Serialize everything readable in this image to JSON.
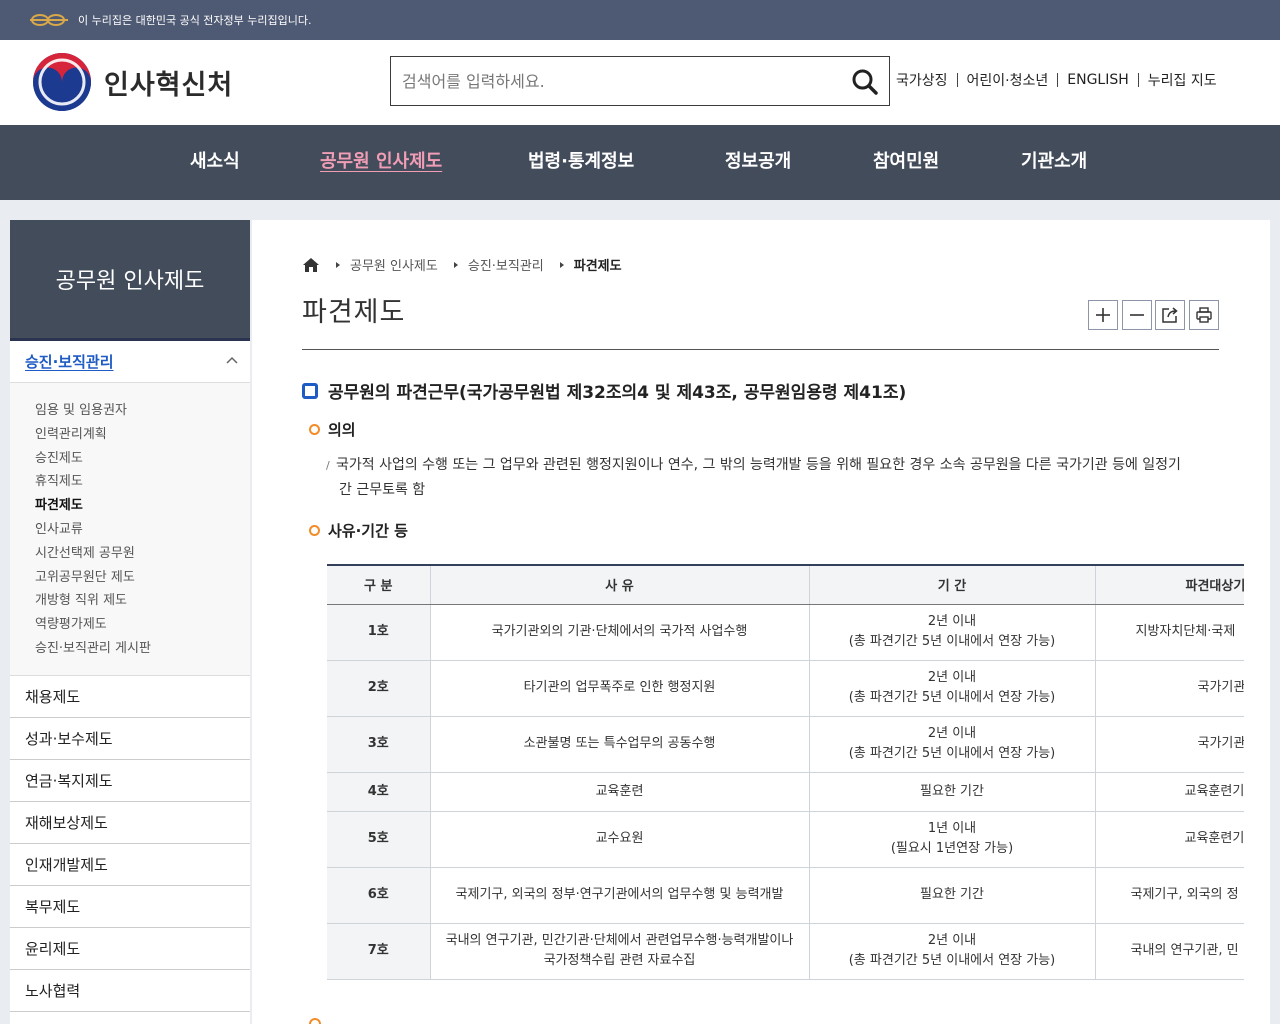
{
  "govbar": {
    "text": "이 누리집은 대한민국 공식 전자정부 누리집입니다."
  },
  "header": {
    "logo_text": "인사혁신처",
    "search_placeholder": "검색어를 입력하세요.",
    "utils": [
      "국가상징",
      "어린이·청소년",
      "ENGLISH",
      "누리집 지도"
    ]
  },
  "gnb": {
    "items": [
      {
        "label": "새소식"
      },
      {
        "label": "공무원 인사제도",
        "active": true
      },
      {
        "label": "법령·통계정보"
      },
      {
        "label": "정보공개"
      },
      {
        "label": "참여민원"
      },
      {
        "label": "기관소개"
      }
    ]
  },
  "lnb": {
    "title": "공무원 인사제도",
    "section": "승진·보직관리",
    "sub_items": [
      "임용 및 임용권자",
      "인력관리계획",
      "승진제도",
      "휴직제도",
      "파견제도",
      "인사교류",
      "시간선택제 공무원",
      "고위공무원단 제도",
      "개방형 직위 제도",
      "역량평가제도",
      "승진·보직관리 게시판"
    ],
    "current": "파견제도",
    "groups": [
      "채용제도",
      "성과·보수제도",
      "연금·복지제도",
      "재해보상제도",
      "인재개발제도",
      "복무제도",
      "윤리제도",
      "노사협력"
    ]
  },
  "breadcrumb": [
    "공무원 인사제도",
    "승진·보직관리",
    "파견제도"
  ],
  "page": {
    "title": "파견제도",
    "h3": "공무원의 파견근무(국가공무원법 제32조의4 및 제43조, 공무원임용령 제41조)",
    "h4_meaning": "의의",
    "meaning_line1": "국가적 사업의 수행 또는 그 업무와 관련된 행정지원이나 연수, 그 밖의 능력개발 등을 위해 필요한 경우 소속 공무원을 다른 국가기관 등에 일정기",
    "meaning_line2": "간 근무토록 함",
    "h4_reason": "사유·기간 등"
  },
  "table": {
    "headers": [
      "구 분",
      "사 유",
      "기 간",
      "파견대상기"
    ],
    "rows": [
      {
        "no": "1호",
        "reason": "국가기관외의 기관·단체에서의 국가적 사업수행",
        "period1": "2년 이내",
        "period2": "(총 파견기간 5년 이내에서 연장 가능)",
        "target": "지방자치단체·국제"
      },
      {
        "no": "2호",
        "reason": "타기관의 업무폭주로 인한 행정지원",
        "period1": "2년 이내",
        "period2": "(총 파견기간 5년 이내에서 연장 가능)",
        "target": "국가기관"
      },
      {
        "no": "3호",
        "reason": "소관불명 또는 특수업무의 공동수행",
        "period1": "2년 이내",
        "period2": "(총 파견기간 5년 이내에서 연장 가능)",
        "target": "국가기관"
      },
      {
        "no": "4호",
        "reason": "교육훈련",
        "period1": "필요한 기간",
        "period2": "",
        "target": "교육훈련기"
      },
      {
        "no": "5호",
        "reason": "교수요원",
        "period1": "1년 이내",
        "period2": "(필요시 1년연장 가능)",
        "target": "교육훈련기"
      },
      {
        "no": "6호",
        "reason": "국제기구, 외국의 정부·연구기관에서의 업무수행 및 능력개발",
        "period1": "필요한 기간",
        "period2": "",
        "target": "국제기구, 외국의 정"
      },
      {
        "no": "7호",
        "reason": "국내의 연구기관, 민간기관·단체에서 관련업무수행·능력개발이나 국가정책수립 관련 자료수집",
        "period1": "2년 이내",
        "period2": "(총 파견기간 5년 이내에서 연장 가능)",
        "target": "국내의 연구기관, 민"
      }
    ]
  },
  "icons": [
    "e-gov-emblem-icon",
    "government-logo-icon",
    "search-icon",
    "home-icon",
    "chevron-up-icon",
    "zoom-in-icon",
    "zoom-out-icon",
    "share-icon",
    "print-icon"
  ],
  "colors": {
    "gnb_bg": "#434c5b",
    "gnb_active": "#f19db5",
    "accent_blue": "#1f5bc4",
    "orange": "#f28c28"
  }
}
